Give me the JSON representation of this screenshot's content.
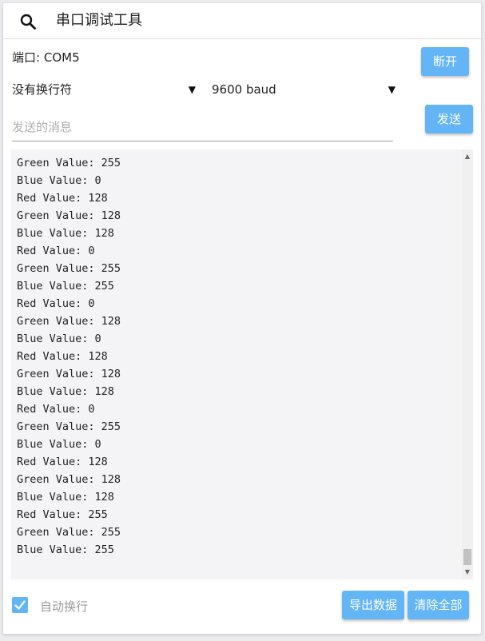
{
  "header": {
    "title": "串口调试工具",
    "search_icon": "search-icon"
  },
  "connection": {
    "port_label": "端口:",
    "port_value": "COM5",
    "disconnect_label": "断开"
  },
  "settings": {
    "line_ending_selected": "没有换行符",
    "baud_selected": "9600 baud"
  },
  "message": {
    "placeholder": "发送的消息",
    "value": "",
    "send_label": "发送"
  },
  "log": {
    "lines": [
      "Green Value: 255",
      "Blue Value: 0",
      "Red Value: 128",
      "Green Value: 128",
      "Blue Value: 128",
      "Red Value: 0",
      "Green Value: 255",
      "Blue Value: 255",
      "Red Value: 0",
      "Green Value: 128",
      "Blue Value: 0",
      "Red Value: 128",
      "Green Value: 128",
      "Blue Value: 128",
      "Red Value: 0",
      "Green Value: 255",
      "Blue Value: 0",
      "Red Value: 128",
      "Green Value: 128",
      "Blue Value: 128",
      "Red Value: 255",
      "Green Value: 255",
      "Blue Value: 255"
    ]
  },
  "footer": {
    "auto_wrap_label": "自动换行",
    "auto_wrap_checked": true,
    "export_label": "导出数据",
    "clear_label": "清除全部"
  },
  "colors": {
    "accent": "#64b5f6",
    "log_background": "#f4f4f6"
  }
}
